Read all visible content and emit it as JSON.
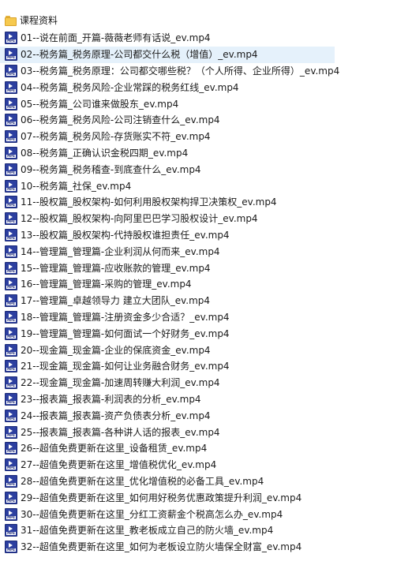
{
  "folder": {
    "name": "课程资料",
    "icon": "folder-icon",
    "color": "#f6c94e"
  },
  "file_icon": {
    "name": "mp4-file-icon",
    "text": "MP4",
    "color": "#2c3fa0"
  },
  "selection_color": "#e5f1fb",
  "selected_index": 1,
  "files": [
    "01--说在前面_开篇-薇薇老师有话说_ev.mp4",
    "02--税务篇_税务原理-公司都交什么税（增值）_ev.mp4",
    "03--税务篇_税务原理：公司都交哪些税？（个人所得、企业所得）_ev.mp4",
    "04--税务篇_税务风险-企业常踩的税务红线_ev.mp4",
    "05--税务篇_公司谁来做股东_ev.mp4",
    "06--税务篇_税务风险-公司注销查什么_ev.mp4",
    "07--税务篇_税务风险-存货账实不符_ev.mp4",
    "08--税务篇_正确认识金税四期_ev.mp4",
    "09--税务篇_税务稽查-到底查什么_ev.mp4",
    "10--税务篇_社保_ev.mp4",
    "11--股权篇_股权架构-如何利用股权架构捍卫决策权_ev.mp4",
    "12--股权篇_股权架构-向阿里巴巴学习股权设计_ev.mp4",
    "13--股权篇_股权架构-代持股权谁担责任_ev.mp4",
    "14--管理篇_管理篇-企业利润从何而来_ev.mp4",
    "15--管理篇_管理篇-应收账款的管理_ev.mp4",
    "16--管理篇_管理篇-采购的管理_ev.mp4",
    "17--管理篇_卓越领导力 建立大团队_ev.mp4",
    "18--管理篇_管理篇-注册资金多少合适？_ev.mp4",
    "19--管理篇_管理篇-如何面试一个好财务_ev.mp4",
    "20--现金篇_现金篇-企业的保底资金_ev.mp4",
    "21--现金篇_现金篇-如何让业务融合财务_ev.mp4",
    "22--现金篇_现金篇-加速周转赚大利润_ev.mp4",
    "23--报表篇_报表篇-利润表的分析_ev.mp4",
    "24--报表篇_报表篇-资产负债表分析_ev.mp4",
    "25--报表篇_报表篇-各种讲人话的报表_ev.mp4",
    "26--超值免费更新在这里_设备租赁_ev.mp4",
    "27--超值免费更新在这里_增值税优化_ev.mp4",
    "28--超值免费更新在这里_优化增值税的必备工具_ev.mp4",
    "29--超值免费更新在这里_如何用好税务优惠政策提升利润_ev.mp4",
    "30--超值免费更新在这里_分红工资薪金个税高怎么办_ev.mp4",
    "31--超值免费更新在这里_教老板成立自己的防火墙_ev.mp4",
    "32--超值免费更新在这里_如何为老板设立防火墙保全财富_ev.mp4"
  ]
}
